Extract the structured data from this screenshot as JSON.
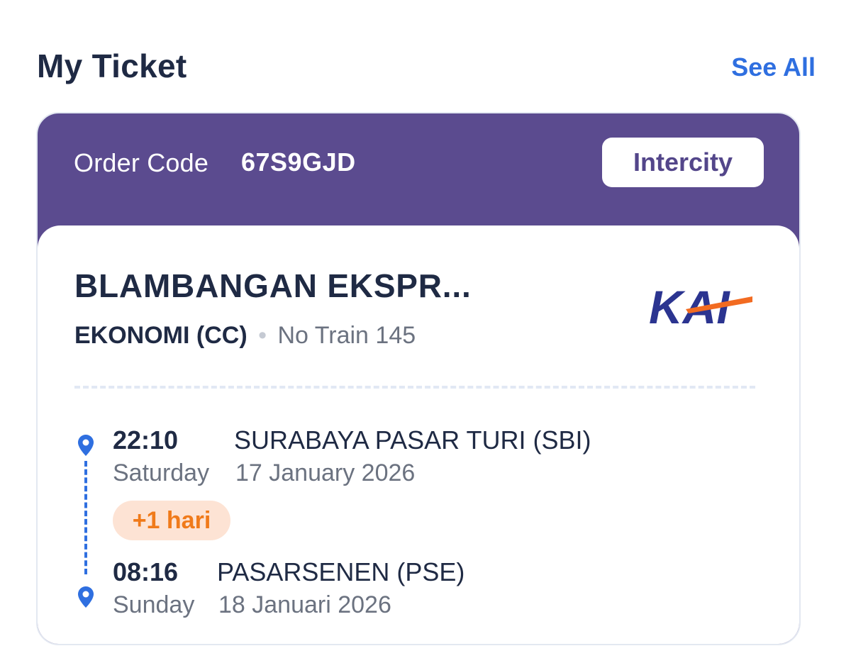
{
  "header": {
    "title": "My Ticket",
    "see_all": "See All"
  },
  "ticket": {
    "order_label": "Order Code",
    "order_code": "67S9GJD",
    "class_badge": "Intercity",
    "train_name": "BLAMBANGAN EKSPR...",
    "train_class": "EKONOMI (CC)",
    "separator": "•",
    "train_no": "No Train 145",
    "logo_text": "KAI",
    "departure": {
      "time": "22:10",
      "station": "SURABAYA PASAR TURI (SBI)",
      "day": "Saturday",
      "date": "17 January 2026"
    },
    "day_offset": "+1 hari",
    "arrival": {
      "time": "08:16",
      "station": "PASARSENEN (PSE)",
      "day": "Sunday",
      "date": "18 Januari 2026"
    }
  },
  "colors": {
    "header_bg": "#5b4b8f",
    "link": "#2f6fe0",
    "primary_text": "#1f2a44",
    "secondary_text": "#6b7280",
    "badge_bg": "#fde3d4",
    "badge_text": "#f07a1a",
    "logo_blue": "#2b3490",
    "logo_orange": "#f26b21"
  },
  "icons": {
    "pin": "location-pin-icon"
  }
}
